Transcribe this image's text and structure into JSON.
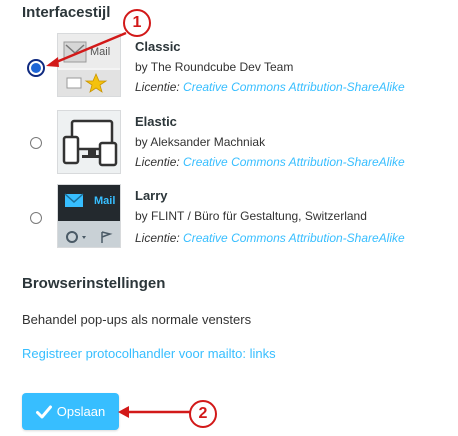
{
  "section_title": "Interfacestijl",
  "skins": [
    {
      "name": "Classic",
      "author": "by The Roundcube Dev Team",
      "license_label": "Licentie:",
      "license_link": "Creative Commons Attribution-ShareAlike",
      "selected": true,
      "thumb_text": "Mail"
    },
    {
      "name": "Elastic",
      "author": "by Aleksander Machniak",
      "license_label": "Licentie:",
      "license_link": "Creative Commons Attribution-ShareAlike",
      "selected": false
    },
    {
      "name": "Larry",
      "author": "by FLINT / Büro für Gestaltung, Switzerland",
      "license_label": "Licentie:",
      "license_link": "Creative Commons Attribution-ShareAlike",
      "selected": false,
      "thumb_text": "Mail"
    }
  ],
  "browser_section": {
    "title": "Browserinstellingen",
    "popup_option": "Behandel pop-ups als normale vensters",
    "protocol_link": "Registreer protocolhandler voor mailto: links"
  },
  "save_button": {
    "label": "Opslaan"
  },
  "annotations": [
    {
      "number": "1"
    },
    {
      "number": "2"
    }
  ],
  "colors": {
    "accent": "#37beff",
    "annotation": "#d21919"
  }
}
